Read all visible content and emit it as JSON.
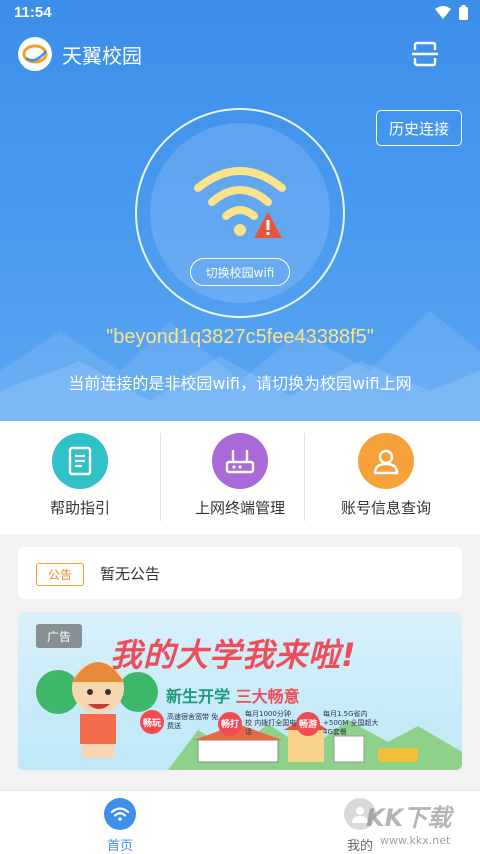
{
  "status_bar": {
    "time": "11:54"
  },
  "app_bar": {
    "title": "天翼校园"
  },
  "hero": {
    "history_button": "历史连接",
    "switch_button": "切换校园wifi",
    "ssid": "\"beyond1q3827c5fee43388f5\"",
    "hint": "当前连接的是非校园wifi，请切换为校园wifi上网"
  },
  "quick_actions": [
    {
      "label": "帮助指引",
      "icon": "document-icon",
      "color": "#2fc0c8"
    },
    {
      "label": "上网终端管理",
      "icon": "router-icon",
      "color": "#a969d9"
    },
    {
      "label": "账号信息查询",
      "icon": "user-icon",
      "color": "#f7a13a"
    }
  ],
  "notice": {
    "tag": "公告",
    "text": "暂无公告"
  },
  "ad": {
    "tag": "广告",
    "headline": "我的大学我来啦!",
    "subline_prefix": "新生开学",
    "subline_highlight": "三大畅意",
    "perks": [
      {
        "badge": "畅玩",
        "text": "高速宿舍宽带 免费送"
      },
      {
        "badge": "畅打",
        "text": "每月1000分钟校 内拨打全国电话"
      },
      {
        "badge": "畅游",
        "text": "每月1.5G省内+500M 全国超大4G套餐"
      }
    ]
  },
  "tab_bar": {
    "tabs": [
      {
        "label": "首页",
        "icon": "wifi-icon",
        "active": true
      },
      {
        "label": "我的",
        "icon": "profile-icon",
        "active": false
      }
    ]
  },
  "watermark": "KK下载",
  "watermark_url": "www.kkx.net",
  "colors": {
    "primary": "#3d8fea",
    "ssid": "#fbe38a",
    "notice": "#f08a1c",
    "ad_headline": "#ee4d5b"
  }
}
